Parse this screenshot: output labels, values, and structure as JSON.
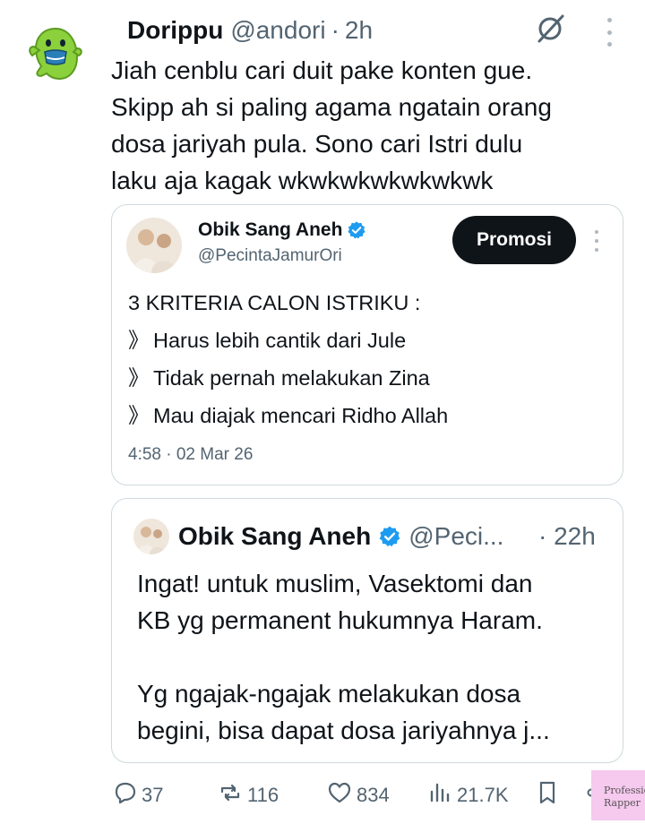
{
  "post": {
    "author_name": "Dorippu",
    "handle": "@andori",
    "separator": "·",
    "time": "2h",
    "text_lines": [
      "Jiah cenblu cari duit pake konten gue.",
      "Skipp ah si paling agama ngatain orang",
      "dosa jariyah pula. Sono cari Istri dulu",
      "laku aja kagak wkwkwkwkwkwkwk"
    ]
  },
  "quoted_card": {
    "author_name": "Obik Sang Aneh",
    "handle": "@PecintaJamurOri",
    "promo_label": "Promosi",
    "title": "3 KRITERIA CALON ISTRIKU :",
    "bullet_symbol": "》",
    "criteria": [
      "Harus lebih cantik dari Jule",
      "Tidak pernah melakukan Zina",
      "Mau diajak mencari Ridho Allah"
    ],
    "timestamp": "4:58 · 02 Mar 26"
  },
  "quoted_tweet": {
    "author_name": "Obik Sang Aneh",
    "handle": "@Peci...",
    "time": "· 22h",
    "lines_para1": [
      "Ingat! untuk muslim, Vasektomi dan",
      "KB yg permanent hukumnya Haram."
    ],
    "lines_para2": [
      "Yg ngajak-ngajak melakukan dosa",
      "begini, bisa dapat dosa jariyahnya j..."
    ]
  },
  "actions": {
    "replies": "37",
    "reposts": "116",
    "likes": "834",
    "views": "21.7K"
  },
  "icons": {
    "grok": "grok-icon",
    "more": "more-icon",
    "verified": "verified-badge-icon",
    "reply": "reply-icon",
    "repost": "repost-icon",
    "like": "heart-icon",
    "views": "views-icon",
    "bookmark": "bookmark-icon",
    "share": "share-icon"
  },
  "colors": {
    "text": "#0f1419",
    "secondary": "#536471",
    "verified": "#1d9bf0",
    "border": "#cfd9de",
    "promo_bg": "#0f1419"
  },
  "watermark": {
    "line1": "Professional",
    "line2": "Rapper"
  }
}
